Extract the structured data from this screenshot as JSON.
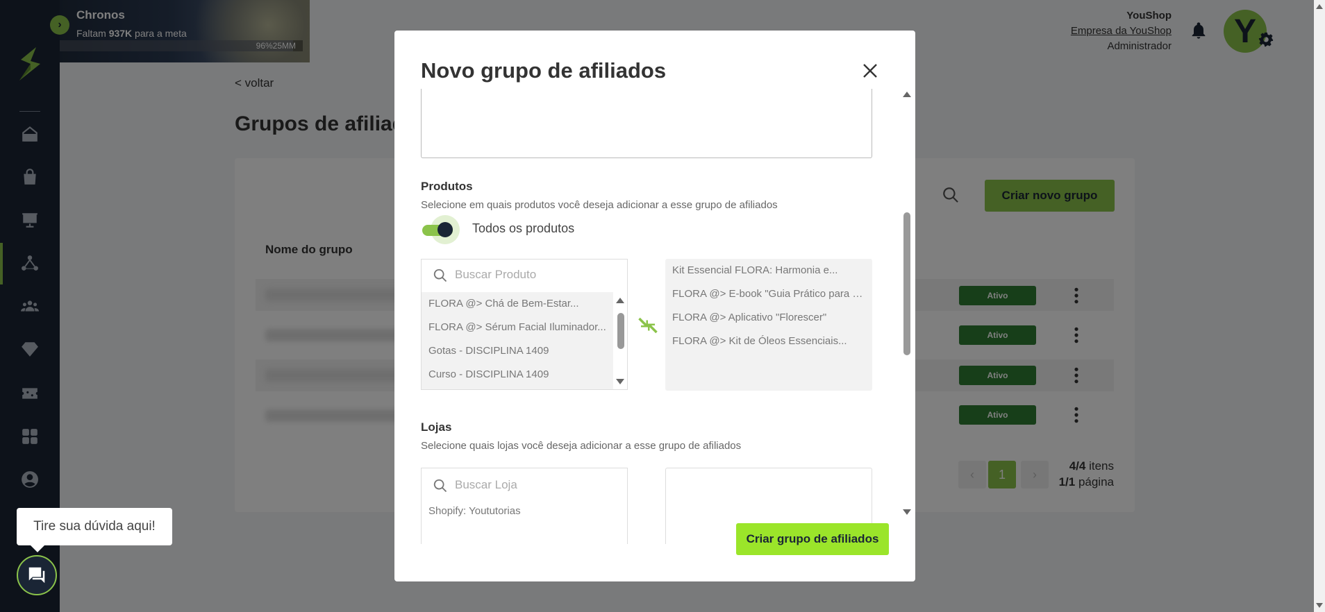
{
  "banner": {
    "title": "Chronos",
    "subtitle_prefix": "Faltam ",
    "subtitle_amount": "937K",
    "subtitle_suffix": " para a meta",
    "progress_text": "96%25MM",
    "progress_percent": 96
  },
  "header": {
    "company_name": "YouShop",
    "company_link": "Empresa da YouShop",
    "role": "Administrador",
    "avatar_letter": "Y",
    "bell_icon": "bell-icon",
    "settings_icon": "gear-icon"
  },
  "sidebar": {
    "logo": "brand-logo",
    "items": [
      {
        "icon": "home-icon"
      },
      {
        "icon": "bag-icon"
      },
      {
        "icon": "presentation-chart-icon"
      },
      {
        "icon": "network-icon",
        "active": true
      },
      {
        "icon": "people-icon"
      },
      {
        "icon": "diamond-icon"
      },
      {
        "icon": "ticket-icon"
      },
      {
        "icon": "apps-grid-icon"
      },
      {
        "icon": "user-circle-icon"
      }
    ]
  },
  "page": {
    "back_label": "< voltar",
    "title": "Grupos de afiliados",
    "create_button": "Criar novo grupo",
    "column_header": "Nome do grupo",
    "rows": [
      {
        "status": "Ativo"
      },
      {
        "status": "Ativo"
      },
      {
        "status": "Ativo"
      },
      {
        "status": "Ativo"
      }
    ],
    "pager": {
      "current_page": "1",
      "items_count": "4/4",
      "items_label": " itens",
      "pages_count": "1/1",
      "pages_label": " página"
    }
  },
  "modal": {
    "title": "Novo grupo de afiliados",
    "products": {
      "title": "Produtos",
      "description": "Selecione em quais produtos você deseja adicionar a esse grupo de afiliados",
      "toggle_label": "Todos os produtos",
      "toggle_on": true,
      "search_placeholder": "Buscar Produto",
      "available": [
        "FLORA @> Chá de Bem-Estar...",
        "FLORA @> Sérum Facial Iluminador...",
        "Gotas - DISCIPLINA 1409",
        "Curso - DISCIPLINA 1409"
      ],
      "selected": [
        "Kit Essencial FLORA: Harmonia e...",
        "FLORA @> E-book \"Guia Prático para o...",
        "FLORA @> Aplicativo \"Florescer\"",
        "FLORA @> Kit de Óleos Essenciais..."
      ]
    },
    "stores": {
      "title": "Lojas",
      "description": "Selecione quais lojas você deseja adicionar a esse grupo de afiliados",
      "search_placeholder": "Buscar Loja",
      "available": [
        "Shopify: Yoututorias"
      ]
    },
    "submit_label": "Criar grupo de afiliados"
  },
  "help": {
    "bubble_text": "Tire sua dúvida aqui!"
  },
  "colors": {
    "accent": "#8bc34a",
    "sidebar": "#1a2535",
    "status_active": "#2e7d32",
    "submit": "#9be52a"
  }
}
